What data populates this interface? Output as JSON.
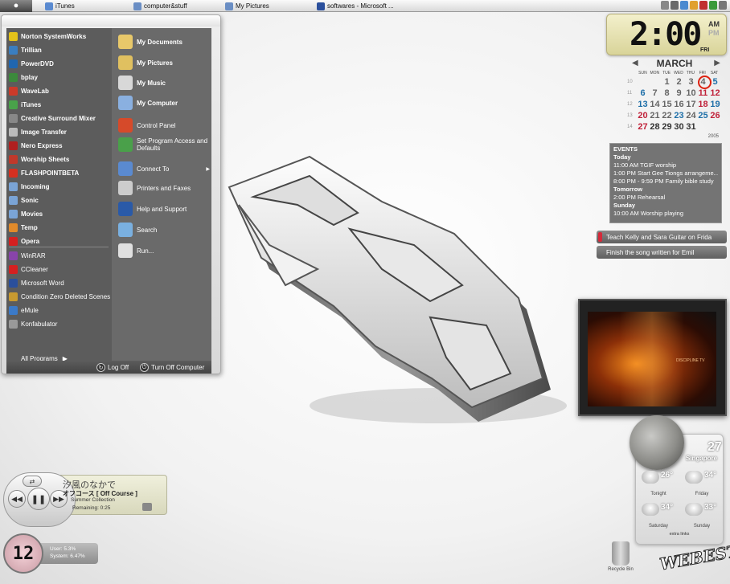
{
  "taskbar": {
    "apple_icon": "apple-icon",
    "tasks": [
      {
        "label": "iTunes",
        "icon": "itunes-icon",
        "color": "#5a8ad0"
      },
      {
        "label": "computer&stuff",
        "icon": "folder-icon",
        "color": "#6a8ec4"
      },
      {
        "label": "My Pictures",
        "icon": "folder-icon",
        "color": "#6a8ec4"
      },
      {
        "label": "softwares - Microsoft ...",
        "icon": "word-icon",
        "color": "#2a4f9c"
      }
    ]
  },
  "start_menu": {
    "left_items": [
      {
        "label": "Norton SystemWorks",
        "color": "#e4c21a",
        "bold": true
      },
      {
        "label": "Trillian",
        "color": "#3a7ec0",
        "bold": true
      },
      {
        "label": "PowerDVD",
        "color": "#2066b0",
        "bold": true
      },
      {
        "label": "bplay",
        "color": "#3c8a3c",
        "bold": true
      },
      {
        "label": "WaveLab",
        "color": "#cc3a2a",
        "bold": true
      },
      {
        "label": "iTunes",
        "color": "#49a24a",
        "bold": true
      },
      {
        "label": "Creative Surround Mixer",
        "color": "#888888",
        "bold": true
      },
      {
        "label": "Image Transfer",
        "color": "#bbbbbb",
        "bold": true
      },
      {
        "label": "Nero Express",
        "color": "#b02020",
        "bold": true
      },
      {
        "label": "Worship Sheets",
        "color": "#c0392b",
        "bold": true
      },
      {
        "label": "FLASHPOINTBETA",
        "color": "#d43020",
        "bold": true
      },
      {
        "label": "Incoming",
        "color": "#7aa4d6",
        "bold": true
      },
      {
        "label": "Sonic",
        "color": "#7aa4d6",
        "bold": true
      },
      {
        "label": "Movies",
        "color": "#7aa4d6",
        "bold": true
      },
      {
        "label": "Temp",
        "color": "#e08a2a",
        "bold": true
      },
      {
        "label": "Opera",
        "color": "#d42020",
        "bold": true
      },
      {
        "label": "WinRAR",
        "color": "#8844aa",
        "bold": false
      },
      {
        "label": "CCleaner",
        "color": "#d42020",
        "bold": false
      },
      {
        "label": "Microsoft Word",
        "color": "#2a4f9c",
        "bold": false
      },
      {
        "label": "Condition Zero Deleted Scenes",
        "color": "#c89a30",
        "bold": false
      },
      {
        "label": "eMule",
        "color": "#3b7ac8",
        "bold": false
      },
      {
        "label": "Konfabulator",
        "color": "#999999",
        "bold": false
      }
    ],
    "all_programs": "All Programs",
    "right_items": [
      {
        "label": "My Documents",
        "icon": "my-documents-icon",
        "color": "#e8c86a",
        "big": true
      },
      {
        "label": "My Pictures",
        "icon": "my-pictures-icon",
        "color": "#e0c060",
        "big": true
      },
      {
        "label": "My Music",
        "icon": "my-music-icon",
        "color": "#d8d8d8",
        "big": true
      },
      {
        "label": "My Computer",
        "icon": "my-computer-icon",
        "color": "#8ab0e0",
        "big": true
      },
      {
        "label": "Control Panel",
        "icon": "control-panel-icon",
        "color": "#d64a2a",
        "big": false
      },
      {
        "label": "Set Program Access and Defaults",
        "icon": "program-access-icon",
        "color": "#4aa04a",
        "big": false
      },
      {
        "label": "Connect To",
        "icon": "connect-to-icon",
        "color": "#5a8ad0",
        "big": false
      },
      {
        "label": "Printers and Faxes",
        "icon": "printer-icon",
        "color": "#cccccc",
        "big": false
      },
      {
        "label": "Help and Support",
        "icon": "help-icon",
        "color": "#2a5aa8",
        "big": false
      },
      {
        "label": "Search",
        "icon": "search-icon",
        "color": "#7ab0e0",
        "big": false
      },
      {
        "label": "Run...",
        "icon": "run-icon",
        "color": "#e0e0e0",
        "big": false
      }
    ],
    "log_off": "Log Off",
    "turn_off": "Turn Off Computer"
  },
  "clock": {
    "time": "2:00",
    "am": "AM",
    "pm": "PM",
    "day": "FRI"
  },
  "calendar": {
    "month": "MARCH",
    "dows": [
      "SUN",
      "MON",
      "TUE",
      "WED",
      "THU",
      "FRI",
      "SAT"
    ],
    "weeks": [
      {
        "wk": "10",
        "days": [
          {
            "d": "",
            "c": ""
          },
          {
            "d": "",
            "c": ""
          },
          {
            "d": "1",
            "c": ""
          },
          {
            "d": "2",
            "c": ""
          },
          {
            "d": "3",
            "c": ""
          },
          {
            "d": "4",
            "c": "today"
          },
          {
            "d": "5",
            "c": "blue"
          }
        ]
      },
      {
        "wk": "11",
        "days": [
          {
            "d": "6",
            "c": "blue"
          },
          {
            "d": "7",
            "c": ""
          },
          {
            "d": "8",
            "c": ""
          },
          {
            "d": "9",
            "c": ""
          },
          {
            "d": "10",
            "c": ""
          },
          {
            "d": "11",
            "c": "red"
          },
          {
            "d": "12",
            "c": "red"
          }
        ]
      },
      {
        "wk": "12",
        "days": [
          {
            "d": "13",
            "c": "blue"
          },
          {
            "d": "14",
            "c": ""
          },
          {
            "d": "15",
            "c": ""
          },
          {
            "d": "16",
            "c": ""
          },
          {
            "d": "17",
            "c": ""
          },
          {
            "d": "18",
            "c": "red"
          },
          {
            "d": "19",
            "c": "blue"
          }
        ]
      },
      {
        "wk": "13",
        "days": [
          {
            "d": "20",
            "c": "red"
          },
          {
            "d": "21",
            "c": ""
          },
          {
            "d": "22",
            "c": ""
          },
          {
            "d": "23",
            "c": "blue"
          },
          {
            "d": "24",
            "c": ""
          },
          {
            "d": "25",
            "c": "blue"
          },
          {
            "d": "26",
            "c": "red"
          }
        ]
      },
      {
        "wk": "14",
        "days": [
          {
            "d": "27",
            "c": "red"
          },
          {
            "d": "28",
            "c": "dark"
          },
          {
            "d": "29",
            "c": "dark"
          },
          {
            "d": "30",
            "c": "dark"
          },
          {
            "d": "31",
            "c": "dark"
          },
          {
            "d": "",
            "c": ""
          },
          {
            "d": "",
            "c": ""
          }
        ]
      }
    ],
    "year": "2005"
  },
  "events": {
    "title": "EVENTS",
    "groups": [
      {
        "heading": "Today",
        "items": [
          "11:00 AM TGIF worship",
          "1:00 PM Start Gee Tiongs arrangeme...",
          "8:00 PM - 9:59 PM Family bible study"
        ]
      },
      {
        "heading": "Tomorrow",
        "items": [
          "2:00 PM Rehearsal"
        ]
      },
      {
        "heading": "Sunday",
        "items": [
          "10:00 AM Worship playing"
        ]
      }
    ]
  },
  "todos": [
    "Teach Kelly and Sara Guitar on Frida",
    "Finish the song written for Emil"
  ],
  "picture_frame": {
    "caption": "DISCIPLINE TV"
  },
  "weather": {
    "temp": "27",
    "city": "Singapore",
    "forecast": [
      {
        "day": "Tonight",
        "temp": "26°"
      },
      {
        "day": "Friday",
        "temp": "34°"
      },
      {
        "day": "Saturday",
        "temp": "34°"
      },
      {
        "day": "Sunday",
        "temp": "33°"
      }
    ],
    "extra": "extra links"
  },
  "player": {
    "title": "汐風のなかで",
    "artist": "オフコース [ Off Course ]",
    "album": "Summer Collection",
    "remaining": "Remaining: 0:25"
  },
  "cpu": {
    "value": "12",
    "user": "User: 5.3%",
    "system": "System: 6.47%"
  },
  "desktop": {
    "recycle_bin": "Recycle Bin",
    "signature": "WEBEST"
  }
}
